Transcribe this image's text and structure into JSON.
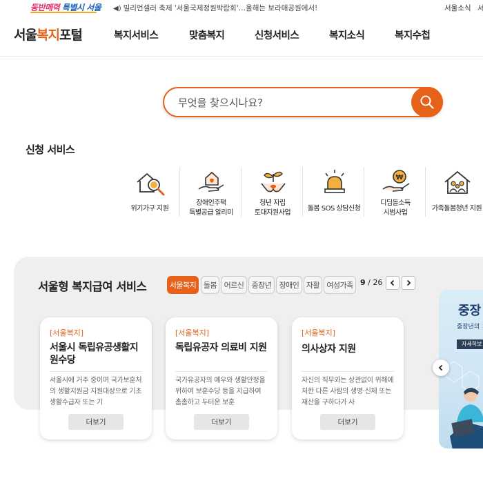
{
  "top": {
    "slogan_a": "동반매력",
    "slogan_b": "특별시 서울",
    "notice": "밀리언셀러 축제 '서울국제정원박람회'…올해는 보라매공원에서!",
    "links": [
      "서울소식",
      "서"
    ]
  },
  "header": {
    "logo_a": "서울",
    "logo_b": "복지",
    "logo_c": "포털",
    "nav": [
      "복지서비스",
      "맞춤복지",
      "신청서비스",
      "복지소식",
      "복지수첩"
    ]
  },
  "search": {
    "placeholder": "무엇을 찾으시나요?"
  },
  "apply": {
    "title": "신청 서비스",
    "items": [
      {
        "label": "위기가구 지원",
        "icon": "house-magnifier-icon"
      },
      {
        "label": "장애인주택\n특별공급 알리미",
        "icon": "house-hand-icon"
      },
      {
        "label": "청년 자립\n토대지원사업",
        "icon": "sprout-hands-icon"
      },
      {
        "label": "돌봄 SOS 상담신청",
        "icon": "siren-icon"
      },
      {
        "label": "디딤돌소득\n시범사업",
        "icon": "coin-hand-icon"
      },
      {
        "label": "가족돌봄청년 지원",
        "icon": "family-house-icon"
      }
    ]
  },
  "benefit": {
    "title": "서울형 복지급여 서비스",
    "tabs": [
      "서울복지",
      "돌봄",
      "어르신",
      "중장년",
      "장애인",
      "자활",
      "여성가족"
    ],
    "active_tab": "서울복지",
    "page_current": "9",
    "page_sep": " / ",
    "page_total": "26",
    "cards": [
      {
        "tag": "[서울복지]",
        "title": "서울시 독립유공생활지원수당",
        "desc": "서울시에 거주 중이며 국가보훈처의 생활지원금 지원대상으로 기초생활수급자 또는 기",
        "more": "더보기"
      },
      {
        "tag": "[서울복지]",
        "title": "독립유공자 의료비 지원",
        "desc": "국가유공자의 예우와 생활안정을 위하여 보훈수당 등을 지급하여 촘촘하고 두터운 보훈",
        "more": "더보기"
      },
      {
        "tag": "[서울복지]",
        "title": "의사상자 지원",
        "desc": "자신의 직무와는 상관없이 위해에 처한 다른 사람의 생명·신체 또는 재산을 구하다가 사",
        "more": "더보기"
      }
    ],
    "banner": {
      "title": "중장",
      "sub": "중장년의 ㅈ",
      "btn": "자세히보"
    }
  },
  "colors": {
    "accent": "#e6621a",
    "panel": "#efefef"
  }
}
